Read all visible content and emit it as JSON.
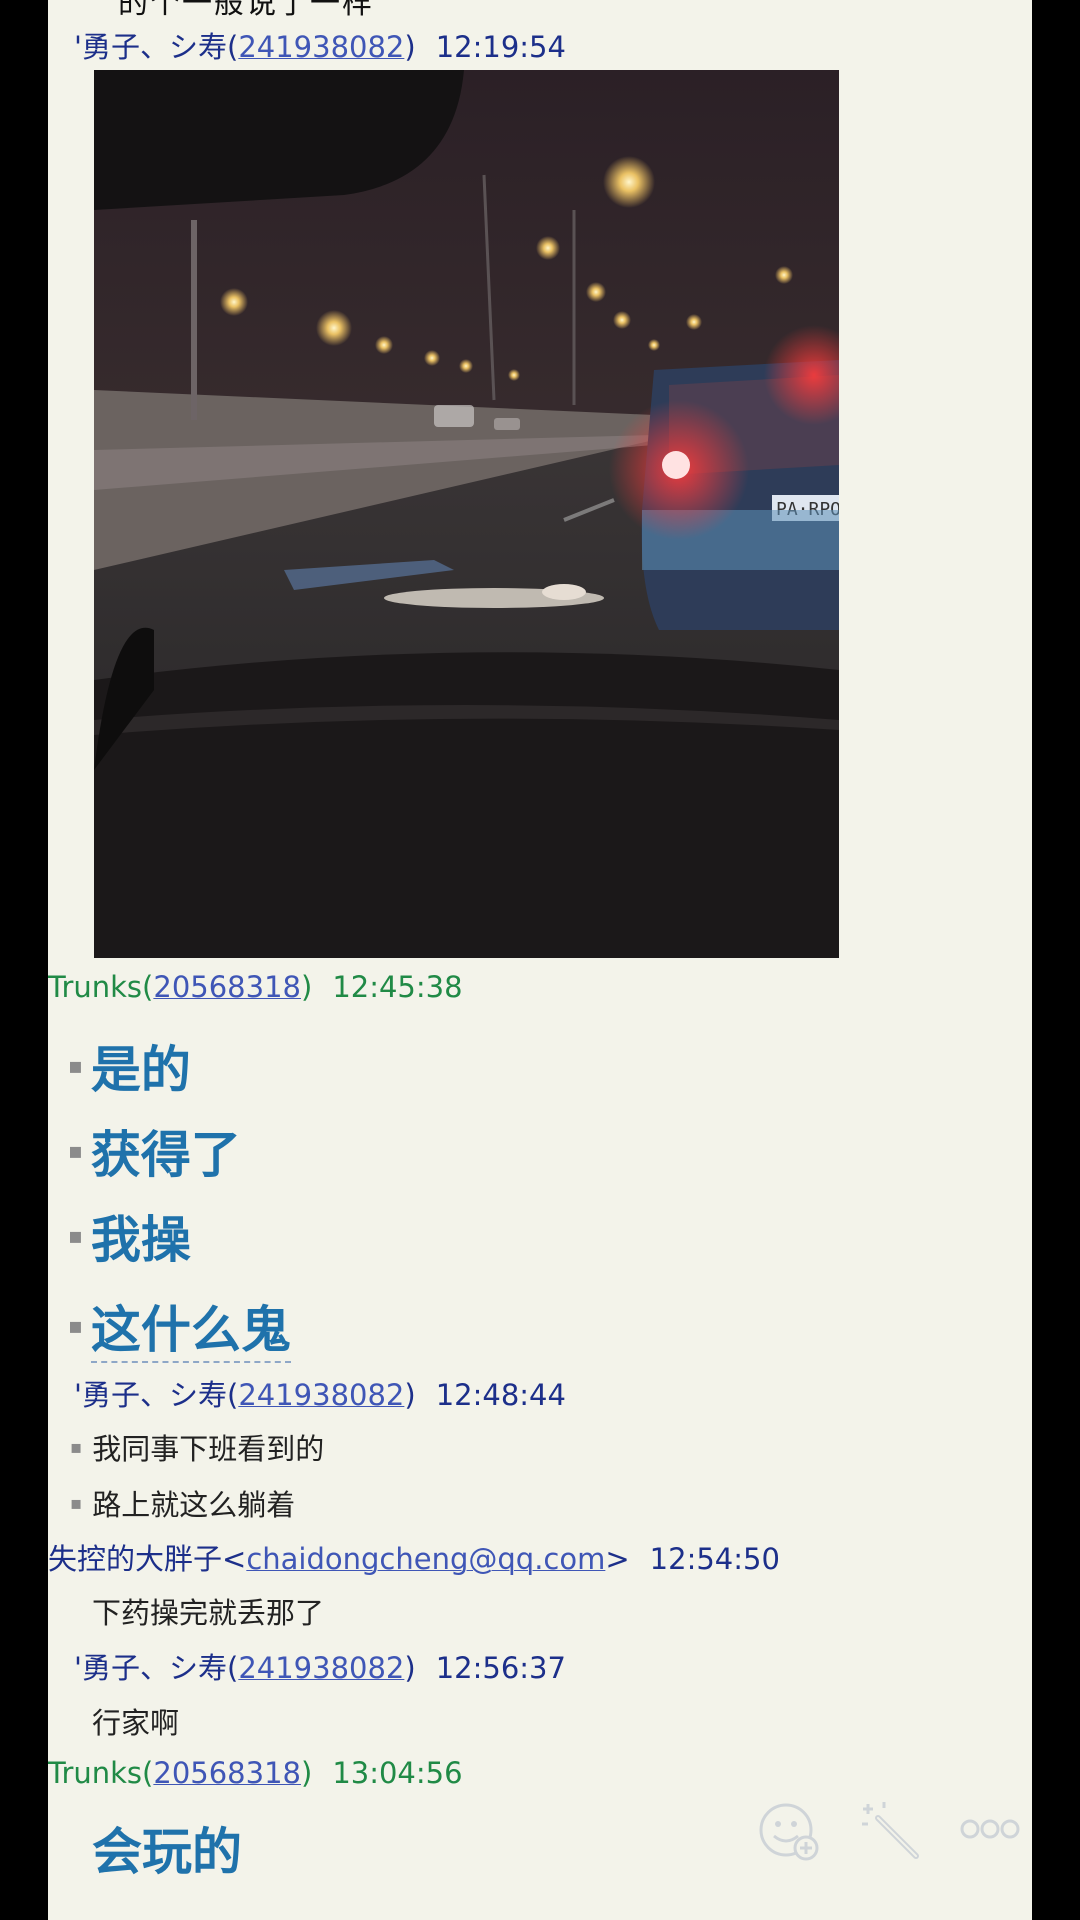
{
  "cut_off_message": "的个一般说了一样",
  "messages": [
    {
      "sender": "'勇子、シ寿",
      "id": "241938082",
      "time": "12:19:54"
    },
    {
      "sender": "Trunks",
      "id": "20568318",
      "time": "12:45:38",
      "lines": [
        "是的",
        "获得了",
        "我操",
        "这什么鬼"
      ]
    },
    {
      "sender": "'勇子、シ寿",
      "id": "241938082",
      "time": "12:48:44",
      "lines": [
        "我同事下班看到的",
        "路上就这么躺着"
      ]
    },
    {
      "sender": "失控的大胖子",
      "email": "chaidongcheng@qq.com",
      "time": "12:54:50",
      "lines": [
        "下药操完就丢那了"
      ]
    },
    {
      "sender": "'勇子、シ寿",
      "id": "241938082",
      "time": "12:56:37",
      "lines": [
        "行家啊"
      ]
    },
    {
      "sender": "Trunks",
      "id": "20568318",
      "time": "13:04:56",
      "lines": [
        "会玩的"
      ]
    }
  ],
  "photo": {
    "plate_text": "PA·RPO"
  },
  "toolbar": {
    "icons": [
      "emoji-add-icon",
      "magic-wand-icon",
      "more-icon"
    ]
  },
  "colors": {
    "panel_bg": "#f3f3ea",
    "big_text": "#1f72ab",
    "green_sender": "#208a46",
    "blue_sender": "#1c2f8a"
  }
}
